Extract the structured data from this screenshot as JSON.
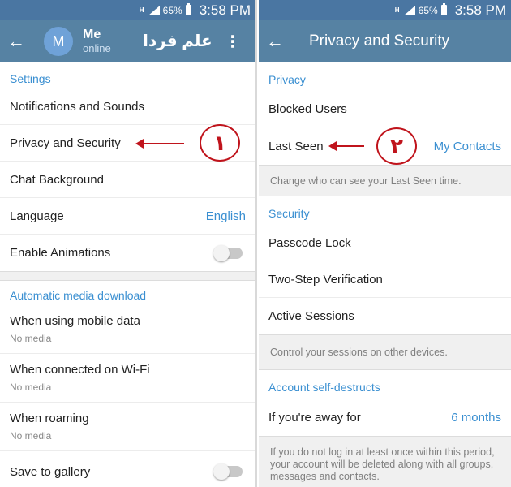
{
  "status": {
    "network": "H",
    "battery": "65%",
    "time": "3:58 PM"
  },
  "left": {
    "user_initial": "M",
    "user_name": "Me",
    "user_status": "online",
    "watermark": "علم فردا",
    "settings_header": "Settings",
    "notifications": "Notifications and Sounds",
    "privacy": "Privacy and Security",
    "chat_background": "Chat Background",
    "language": "Language",
    "language_value": "English",
    "animations": "Enable Animations",
    "media_header": "Automatic media download",
    "mobile_data": "When using mobile data",
    "mobile_data_value": "No media",
    "wifi": "When connected on Wi-Fi",
    "wifi_value": "No media",
    "roaming": "When roaming",
    "roaming_value": "No media",
    "save_gallery": "Save to gallery",
    "step_marker": "١"
  },
  "right": {
    "title": "Privacy and Security",
    "privacy_header": "Privacy",
    "blocked": "Blocked Users",
    "last_seen": "Last Seen",
    "last_seen_value": "My Contacts",
    "last_seen_info": "Change who can see your Last Seen time.",
    "security_header": "Security",
    "passcode": "Passcode Lock",
    "two_step": "Two-Step Verification",
    "sessions": "Active Sessions",
    "sessions_info": "Control your sessions on other devices.",
    "destruct_header": "Account self-destructs",
    "away": "If you're away for",
    "away_value": "6 months",
    "destruct_info": "If you do not log in at least once within this period, your account will be deleted along with all groups, messages and contacts.",
    "step_marker": "٢"
  }
}
